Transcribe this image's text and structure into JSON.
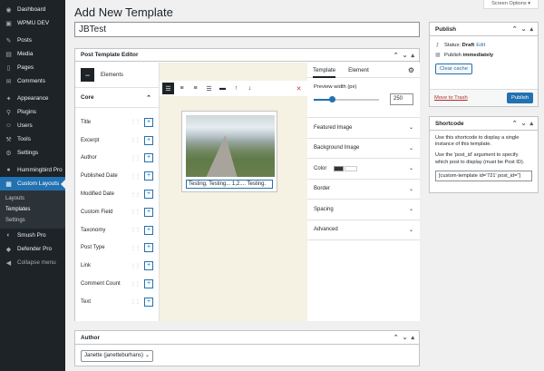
{
  "sidebar": {
    "items": [
      {
        "label": "Dashboard",
        "icon": "dashboard-icon",
        "glyph": "◉"
      },
      {
        "label": "WPMU DEV",
        "icon": "wpmudev-icon",
        "glyph": "▣"
      },
      {
        "label": "Posts",
        "icon": "pin-icon",
        "glyph": "✎"
      },
      {
        "label": "Media",
        "icon": "media-icon",
        "glyph": "▤"
      },
      {
        "label": "Pages",
        "icon": "pages-icon",
        "glyph": "▯"
      },
      {
        "label": "Comments",
        "icon": "comments-icon",
        "glyph": "✉"
      },
      {
        "label": "Appearance",
        "icon": "appearance-icon",
        "glyph": "✦"
      },
      {
        "label": "Plugins",
        "icon": "plugins-icon",
        "glyph": "⚲"
      },
      {
        "label": "Users",
        "icon": "users-icon",
        "glyph": "☺"
      },
      {
        "label": "Tools",
        "icon": "tools-icon",
        "glyph": "⚒"
      },
      {
        "label": "Settings",
        "icon": "settings-icon",
        "glyph": "⚙"
      },
      {
        "label": "Hummingbird Pro",
        "icon": "hummingbird-icon",
        "glyph": "●"
      },
      {
        "label": "Custom Layouts",
        "icon": "layouts-icon",
        "glyph": "▦"
      },
      {
        "label": "Smush Pro",
        "icon": "smush-icon",
        "glyph": "◐"
      },
      {
        "label": "Defender Pro",
        "icon": "defender-icon",
        "glyph": "◆"
      },
      {
        "label": "Collapse menu",
        "icon": "collapse-icon",
        "glyph": "◀"
      }
    ],
    "submenu": [
      "Layouts",
      "Templates",
      "Settings"
    ]
  },
  "screen_options": "Screen Options ▾",
  "page_title": "Add New Template",
  "title_value": "JBTest",
  "editor": {
    "heading": "Post Template Editor",
    "elements_label": "Elements",
    "core_label": "Core",
    "elements": [
      "Title",
      "Excerpt",
      "Author",
      "Published Date",
      "Modified Date",
      "Custom Field",
      "Taxonomy",
      "Post Type",
      "Link",
      "Comment Count",
      "Text"
    ],
    "caption": "Testing, Testing... 1,2.... Testing.",
    "tabs": [
      "Template",
      "Element"
    ],
    "preview_width_label": "Preview width (px)",
    "preview_width_value": "250",
    "preview_width_fraction": 0.28,
    "sections": [
      "Featured Image",
      "Background Image",
      "Color",
      "Border",
      "Spacing",
      "Advanced"
    ]
  },
  "author_box": {
    "heading": "Author",
    "selected": "Janette (janetteburhans)"
  },
  "publish_box": {
    "heading": "Publish",
    "status_label": "Status:",
    "status_value": "Draft",
    "edit_link": "Edit",
    "publish_label": "Publish",
    "publish_value": "immediately",
    "clear_cache": "Clear cache",
    "trash_link": "Move to Trash",
    "publish_button": "Publish"
  },
  "shortcode_box": {
    "heading": "Shortcode",
    "text1": "Use this shortcode to display a single instance of this template.",
    "text2": "Use the 'post_id' argument to specify which post to display (must be Post ID).",
    "shortcode": "[custom-template id='721' post_id='']"
  },
  "colors": {
    "accent": "#2271b1",
    "sidebar_bg": "#1d2327",
    "canvas_bg": "#f5f1e3",
    "danger": "#b32d2e"
  }
}
